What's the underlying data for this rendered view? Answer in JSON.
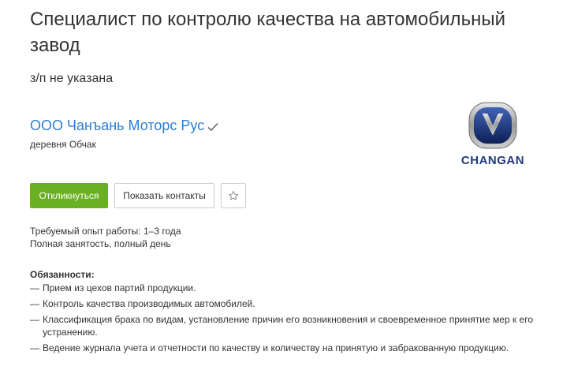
{
  "vacancy": {
    "title": "Специалист по контролю качества на автомобильный завод",
    "salary": "з/п не указана"
  },
  "company": {
    "name": "ООО Чанъань Моторс Рус",
    "location": "деревня Обчак",
    "logo_text": "CHANGAN",
    "verified_icon": "check-icon",
    "brand_color": "#1f3b78"
  },
  "actions": {
    "respond_label": "Откликнуться",
    "contacts_label": "Показать контакты",
    "favorite_icon": "star-icon",
    "respond_color": "#6ab023"
  },
  "details": {
    "experience": "Требуемый опыт работы: 1–3 года",
    "employment": "Полная занятость, полный день"
  },
  "responsibilities": {
    "title": "Обязанности:",
    "dash": "—",
    "items": [
      "Прием из цехов партий продукции.",
      "Контроль качества производимых автомобилей.",
      "Классификация брака по видам, установление причин его возникновения и своевременное принятие мер к его устранению.",
      "Ведение журнала учета и отчетности по качеству и количеству на принятую и забракованную продукцию."
    ]
  }
}
